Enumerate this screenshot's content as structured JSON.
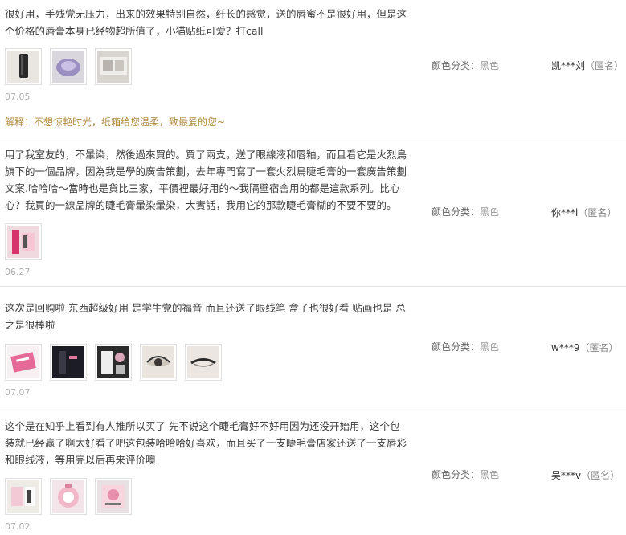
{
  "spec_label": "颜色分类：",
  "reviews": [
    {
      "text": "很好用，手残党无压力，出来的效果特别自然，纤长的感觉，送的唇蜜不是很好用，但是这个价格的唇膏本身已经物超所值了，小猫贴纸可爱？打call",
      "date": "07.05",
      "reply": "解释：不想惊艳时光，纸箱给您温柔，致最爱的您~",
      "spec_value": "黑色",
      "user": "凯***刘",
      "badge": "（匿名）"
    },
    {
      "text": "用了我室友的，不暈染，然後過來買的。買了兩支，送了眼線液和唇釉，而且看它是火烈鳥旗下的一個品牌，因為我是學的廣告策劃，去年專門寫了一套火烈鳥睫毛膏的一套廣告策劃文案.哈哈哈～當時也是貨比三家，平價裡最好用的～我隔壁宿舍用的都是這款系列。比心心？我買的一線品牌的睫毛膏暈染暈染，大實話，我用它的那款睫毛膏糊的不要不要的。",
      "date": "06.27",
      "spec_value": "黑色",
      "user": "你***i",
      "badge": "（匿名）"
    },
    {
      "text": "这次是回购啦 东西超级好用 是学生党的福音 而且还送了眼线笔 盒子也很好看 贴画也是 总之是很棒啦",
      "date": "07.07",
      "spec_value": "黑色",
      "user": "w***9",
      "badge": "（匿名）"
    },
    {
      "text": "这个是在知乎上看到有人推所以买了 先不说这个睫毛膏好不好用因为还没开始用，这个包装就已经赢了啊太好看了吧这包装哈哈哈好喜欢，而且买了一支睫毛膏店家还送了一支唇彩和眼线液，等用完以后再来评价噢",
      "date": "07.02",
      "spec_value": "黑色",
      "user": "吴***v",
      "badge": "（匿名）"
    }
  ]
}
